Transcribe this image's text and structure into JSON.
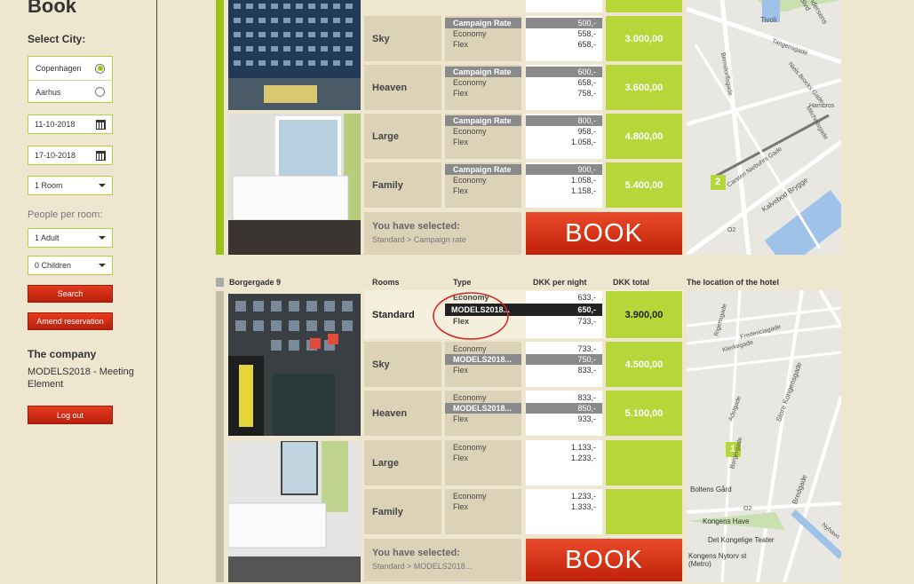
{
  "sidebar": {
    "title": "Book",
    "select_city_label": "Select City:",
    "cities": [
      {
        "name": "Copenhagen",
        "selected": true
      },
      {
        "name": "Aarhus",
        "selected": false
      }
    ],
    "checkin": "11-10-2018",
    "checkout": "17-10-2018",
    "rooms": "1 Room",
    "people_label": "People per room:",
    "adults": "1 Adult",
    "children": "0 Children",
    "search_label": "Search",
    "amend_label": "Amend reservation",
    "company_label": "The company",
    "company_value": "MODELS2018 - Meeting Element",
    "logout_label": "Log out"
  },
  "hotel_top": {
    "rooms": [
      {
        "name": "Sky",
        "types": [
          "Campaign Rate",
          "Economy",
          "Flex"
        ],
        "prices": [
          "500,-",
          "558,-",
          "658,-"
        ],
        "total": "3.000,00"
      },
      {
        "name": "Heaven",
        "types": [
          "Campaign Rate",
          "Economy",
          "Flex"
        ],
        "prices": [
          "600,-",
          "658,-",
          "758,-"
        ],
        "total": "3.600,00"
      },
      {
        "name": "Large",
        "types": [
          "Campaign Rate",
          "Economy",
          "Flex"
        ],
        "prices": [
          "800,-",
          "958,-",
          "1.058,-"
        ],
        "total": "4.800,00"
      },
      {
        "name": "Family",
        "types": [
          "Campaign Rate",
          "Economy",
          "Flex"
        ],
        "prices": [
          "900,-",
          "1.058,-",
          "1.158,-"
        ],
        "total": "5.400,00"
      }
    ],
    "selected_title": "You have selected:",
    "selected_value": "Standard > Campaign rate",
    "book_label": "BOOK",
    "map_labels": [
      "Tivoli",
      "Andersens Blvd",
      "Tietgensgade",
      "Bernstorffsgade",
      "Niels Brocks Gade",
      "Hambros",
      "Mitchellsgade",
      "Kalvebod Brygge",
      "Carsten Niebuhrs Gade",
      "2",
      "O2"
    ]
  },
  "hotel_bottom": {
    "address": "Borgergade 9",
    "col_rooms": "Rooms",
    "col_type": "Type",
    "col_night": "DKK per night",
    "col_total": "DKK total",
    "col_location": "The location of the hotel",
    "rooms": [
      {
        "name": "Standard",
        "types": [
          "Economy",
          "MODELS2018...",
          "Flex"
        ],
        "prices": [
          "633,-",
          "650,-",
          "733,-"
        ],
        "total": "3.900,00"
      },
      {
        "name": "Sky",
        "types": [
          "Economy",
          "MODELS2018...",
          "Flex"
        ],
        "prices": [
          "733,-",
          "750,-",
          "833,-"
        ],
        "total": "4.500,00"
      },
      {
        "name": "Heaven",
        "types": [
          "Economy",
          "MODELS2018...",
          "Flex"
        ],
        "prices": [
          "833,-",
          "850,-",
          "933,-"
        ],
        "total": "5.100,00"
      },
      {
        "name": "Large",
        "types": [
          "Economy",
          "Flex"
        ],
        "prices": [
          "1.133,-",
          "1.233,-"
        ],
        "total": ""
      },
      {
        "name": "Family",
        "types": [
          "Economy",
          "Flex"
        ],
        "prices": [
          "1.233,-",
          "1.333,-"
        ],
        "total": ""
      }
    ],
    "selected_title": "You have selected:",
    "selected_value": "Standard > MODELS2018...",
    "book_label": "BOOK",
    "map_labels": [
      "Rigensgade",
      "Fredericiagade",
      "Klerkegade",
      "Adelgade",
      "Store Kongensgade",
      "Borgergade",
      "Bredgade",
      "Boltens Gård",
      "Kongens Have",
      "Det Kongelige Teater",
      "Kongens Nytorv st (Metro)",
      "Nyhavn",
      "1",
      "O2"
    ]
  },
  "colors": {
    "accent_green": "#b6d63a",
    "accent_red": "#d12c12",
    "background": "#efe6cf",
    "panel": "#dcd2b8"
  }
}
